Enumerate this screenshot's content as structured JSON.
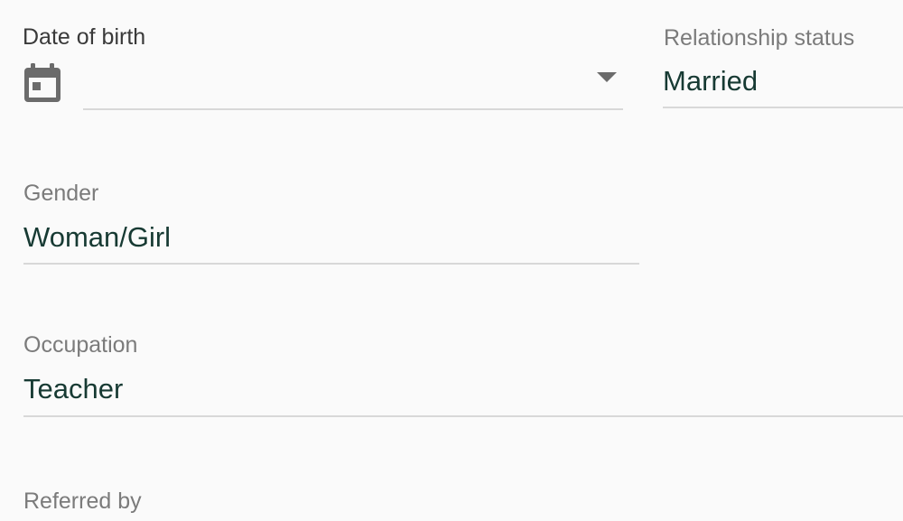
{
  "fields": {
    "date_of_birth": {
      "label": "Date of birth",
      "value": "",
      "icon": "calendar-icon",
      "dropdown_icon": "dropdown-arrow-icon"
    },
    "relationship_status": {
      "label": "Relationship status",
      "value": "Married"
    },
    "gender": {
      "label": "Gender",
      "value": "Woman/Girl"
    },
    "occupation": {
      "label": "Occupation",
      "value": "Teacher"
    },
    "referred_by": {
      "label": "Referred by"
    }
  },
  "colors": {
    "background": "#fafafa",
    "label": "#7b7b7b",
    "value": "#173a33",
    "underline": "#d8d8d8",
    "icon": "#6b6b6b"
  }
}
